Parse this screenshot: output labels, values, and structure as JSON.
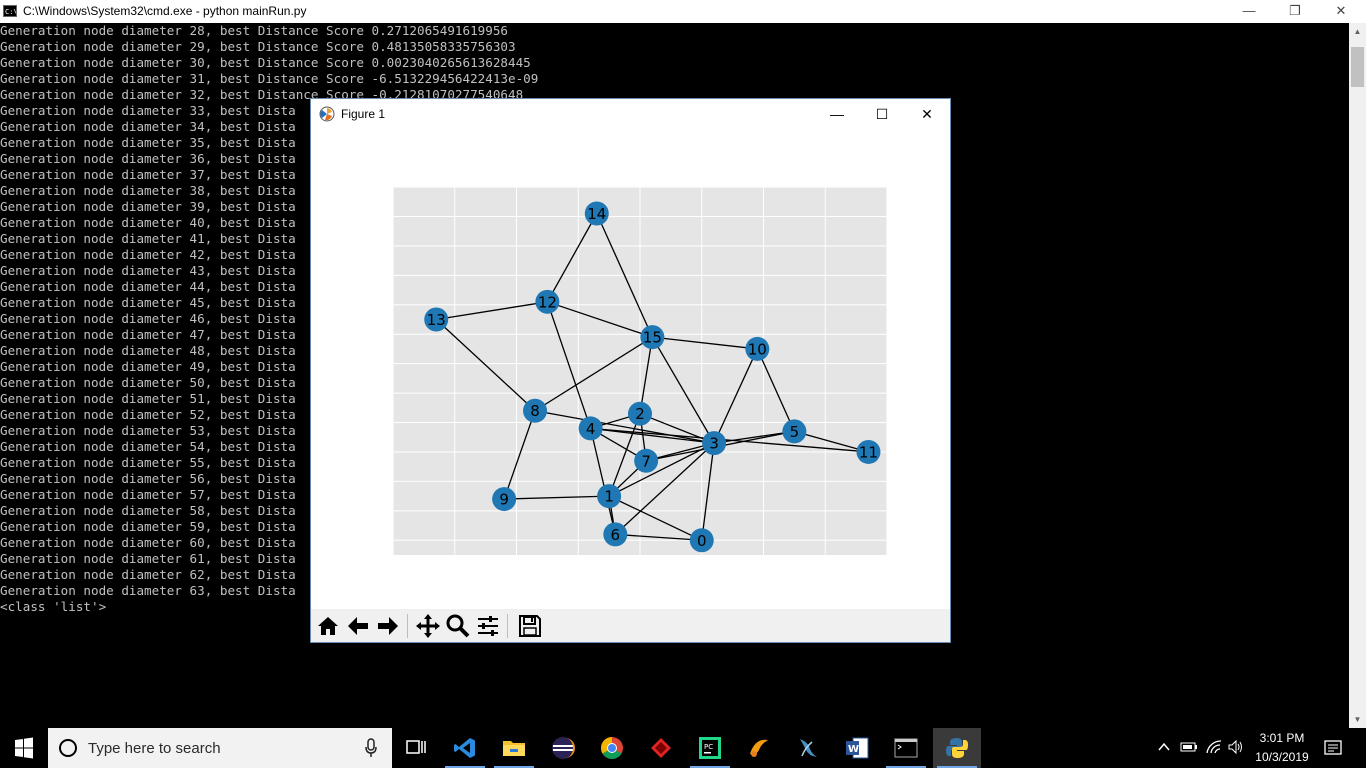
{
  "cmd": {
    "title": "C:\\Windows\\System32\\cmd.exe - python  mainRun.py",
    "icon_label": "C:\\",
    "lines": [
      "Generation node diameter 28, best Distance Score 0.2712065491619956",
      "Generation node diameter 29, best Distance Score 0.48135058335756303",
      "Generation node diameter 30, best Distance Score 0.0023040265613628445",
      "Generation node diameter 31, best Distance Score -6.513229456422413e-09",
      "Generation node diameter 32, best Distance Score -0.21281070277540648",
      "Generation node diameter 33, best Dista",
      "Generation node diameter 34, best Dista",
      "Generation node diameter 35, best Dista",
      "Generation node diameter 36, best Dista",
      "Generation node diameter 37, best Dista",
      "Generation node diameter 38, best Dista",
      "Generation node diameter 39, best Dista",
      "Generation node diameter 40, best Dista",
      "Generation node diameter 41, best Dista",
      "Generation node diameter 42, best Dista",
      "Generation node diameter 43, best Dista",
      "Generation node diameter 44, best Dista",
      "Generation node diameter 45, best Dista",
      "Generation node diameter 46, best Dista",
      "Generation node diameter 47, best Dista",
      "Generation node diameter 48, best Dista",
      "Generation node diameter 49, best Dista",
      "Generation node diameter 50, best Dista",
      "Generation node diameter 51, best Dista",
      "Generation node diameter 52, best Dista",
      "Generation node diameter 53, best Dista",
      "Generation node diameter 54, best Dista",
      "Generation node diameter 55, best Dista",
      "Generation node diameter 56, best Dista",
      "Generation node diameter 57, best Dista",
      "Generation node diameter 58, best Dista",
      "Generation node diameter 59, best Dista",
      "Generation node diameter 60, best Dista",
      "Generation node diameter 61, best Dista",
      "Generation node diameter 62, best Dista",
      "Generation node diameter 63, best Dista",
      "<class 'list'>"
    ],
    "controls": {
      "minimize": "—",
      "restore": "❐",
      "close": "✕"
    }
  },
  "figure": {
    "title": "Figure 1",
    "controls": {
      "minimize": "—",
      "maximize": "☐",
      "close": "✕"
    },
    "toolbar": [
      {
        "name": "home-icon"
      },
      {
        "name": "back-arrow-icon"
      },
      {
        "name": "forward-arrow-icon"
      },
      {
        "name": "pan-icon"
      },
      {
        "name": "zoom-icon"
      },
      {
        "name": "configure-subplots-icon"
      },
      {
        "name": "save-icon"
      }
    ],
    "graph": {
      "node_color": "#1f77b4",
      "edge_color": "#000000",
      "plot_background": "#e5e5e5",
      "grid": true,
      "nodes": [
        {
          "id": "0",
          "x": 5.0,
          "y": -3.0
        },
        {
          "id": "1",
          "x": 3.5,
          "y": -1.5
        },
        {
          "id": "2",
          "x": 4.0,
          "y": 1.3
        },
        {
          "id": "3",
          "x": 5.2,
          "y": 0.3
        },
        {
          "id": "4",
          "x": 3.2,
          "y": 0.8
        },
        {
          "id": "5",
          "x": 6.5,
          "y": 0.7
        },
        {
          "id": "6",
          "x": 3.6,
          "y": -2.8
        },
        {
          "id": "7",
          "x": 4.1,
          "y": -0.3
        },
        {
          "id": "8",
          "x": 2.3,
          "y": 1.4
        },
        {
          "id": "9",
          "x": 1.8,
          "y": -1.6
        },
        {
          "id": "10",
          "x": 5.9,
          "y": 3.5
        },
        {
          "id": "11",
          "x": 7.7,
          "y": 0.0
        },
        {
          "id": "12",
          "x": 2.5,
          "y": 5.1
        },
        {
          "id": "13",
          "x": 0.7,
          "y": 4.5
        },
        {
          "id": "14",
          "x": 3.3,
          "y": 8.1
        },
        {
          "id": "15",
          "x": 4.2,
          "y": 3.9
        }
      ],
      "edges": [
        [
          "14",
          "12"
        ],
        [
          "14",
          "15"
        ],
        [
          "13",
          "12"
        ],
        [
          "13",
          "8"
        ],
        [
          "12",
          "15"
        ],
        [
          "12",
          "4"
        ],
        [
          "15",
          "10"
        ],
        [
          "15",
          "8"
        ],
        [
          "15",
          "2"
        ],
        [
          "15",
          "3"
        ],
        [
          "10",
          "3"
        ],
        [
          "10",
          "5"
        ],
        [
          "5",
          "11"
        ],
        [
          "5",
          "3"
        ],
        [
          "5",
          "7"
        ],
        [
          "4",
          "2"
        ],
        [
          "4",
          "3"
        ],
        [
          "4",
          "11"
        ],
        [
          "4",
          "6"
        ],
        [
          "4",
          "7"
        ],
        [
          "8",
          "3"
        ],
        [
          "8",
          "9"
        ],
        [
          "9",
          "1"
        ],
        [
          "2",
          "3"
        ],
        [
          "2",
          "7"
        ],
        [
          "2",
          "1"
        ],
        [
          "3",
          "7"
        ],
        [
          "3",
          "1"
        ],
        [
          "3",
          "6"
        ],
        [
          "3",
          "0"
        ],
        [
          "7",
          "1"
        ],
        [
          "1",
          "6"
        ],
        [
          "1",
          "0"
        ],
        [
          "6",
          "0"
        ]
      ]
    }
  },
  "taskbar": {
    "search_placeholder": "Type here to search",
    "apps": [
      {
        "name": "task-view-icon"
      },
      {
        "name": "vscode-icon"
      },
      {
        "name": "file-explorer-icon"
      },
      {
        "name": "eclipse-icon"
      },
      {
        "name": "chrome-icon"
      },
      {
        "name": "red-app-icon"
      },
      {
        "name": "pycharm-icon"
      },
      {
        "name": "orange-app-icon"
      },
      {
        "name": "mysql-workbench-icon"
      },
      {
        "name": "word-icon"
      },
      {
        "name": "cmd-icon"
      },
      {
        "name": "python-icon"
      }
    ],
    "time": "3:01 PM",
    "date": "10/3/2019"
  }
}
